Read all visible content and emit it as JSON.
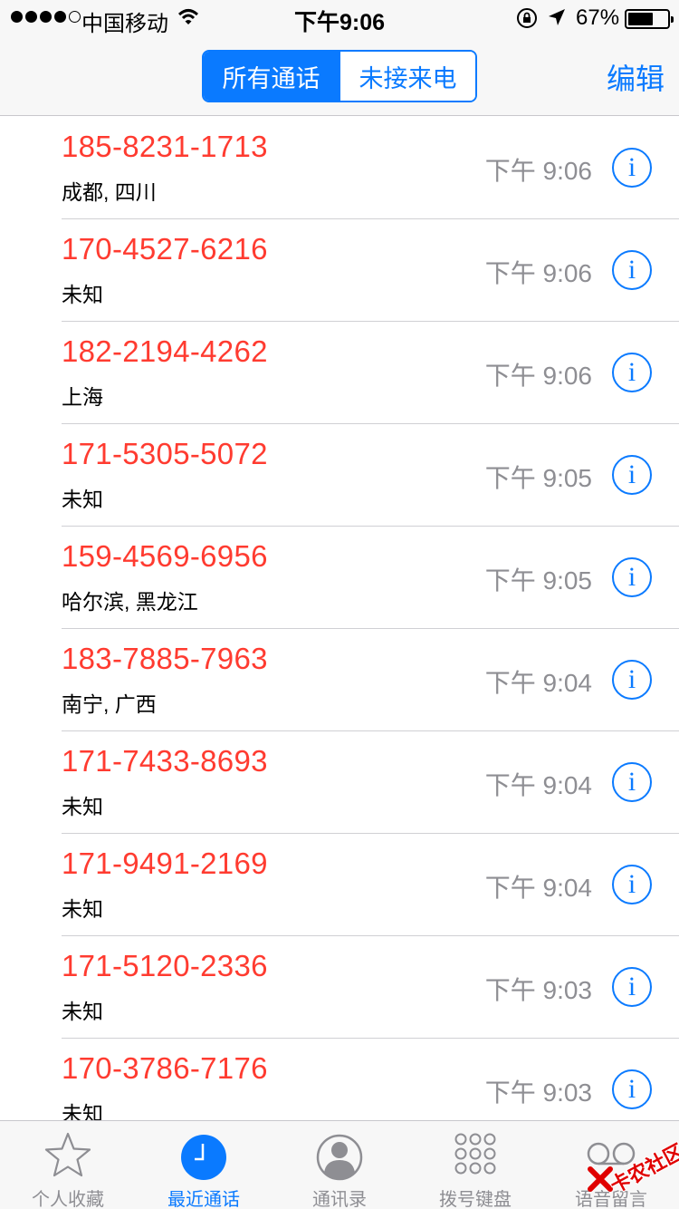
{
  "status_bar": {
    "carrier": "中国移动",
    "time": "下午9:06",
    "battery_percent": "67%",
    "battery_level": 0.67
  },
  "nav": {
    "segments": [
      "所有通话",
      "未接来电"
    ],
    "active_segment": 0,
    "edit_label": "编辑",
    "accent_color": "#0a7aff"
  },
  "calls": [
    {
      "number": "185-8231-1713",
      "location": "成都, 四川",
      "time": "下午 9:06"
    },
    {
      "number": "170-4527-6216",
      "location": "未知",
      "time": "下午 9:06"
    },
    {
      "number": "182-2194-4262",
      "location": "上海",
      "time": "下午 9:06"
    },
    {
      "number": "171-5305-5072",
      "location": "未知",
      "time": "下午 9:05"
    },
    {
      "number": "159-4569-6956",
      "location": "哈尔滨, 黑龙江",
      "time": "下午 9:05"
    },
    {
      "number": "183-7885-7963",
      "location": "南宁, 广西",
      "time": "下午 9:04"
    },
    {
      "number": "171-7433-8693",
      "location": "未知",
      "time": "下午 9:04"
    },
    {
      "number": "171-9491-2169",
      "location": "未知",
      "time": "下午 9:04"
    },
    {
      "number": "171-5120-2336",
      "location": "未知",
      "time": "下午 9:03"
    },
    {
      "number": "170-3786-7176",
      "location": "未知",
      "time": "下午 9:03"
    }
  ],
  "missed_call_color": "#ff3b30",
  "tabs": [
    {
      "label": "个人收藏",
      "icon": "star-icon"
    },
    {
      "label": "最近通话",
      "icon": "clock-icon"
    },
    {
      "label": "通讯录",
      "icon": "contacts-icon"
    },
    {
      "label": "拨号键盘",
      "icon": "keypad-icon"
    },
    {
      "label": "语音留言",
      "icon": "voicemail-icon"
    }
  ],
  "active_tab": 1,
  "watermark": "卡农社区"
}
